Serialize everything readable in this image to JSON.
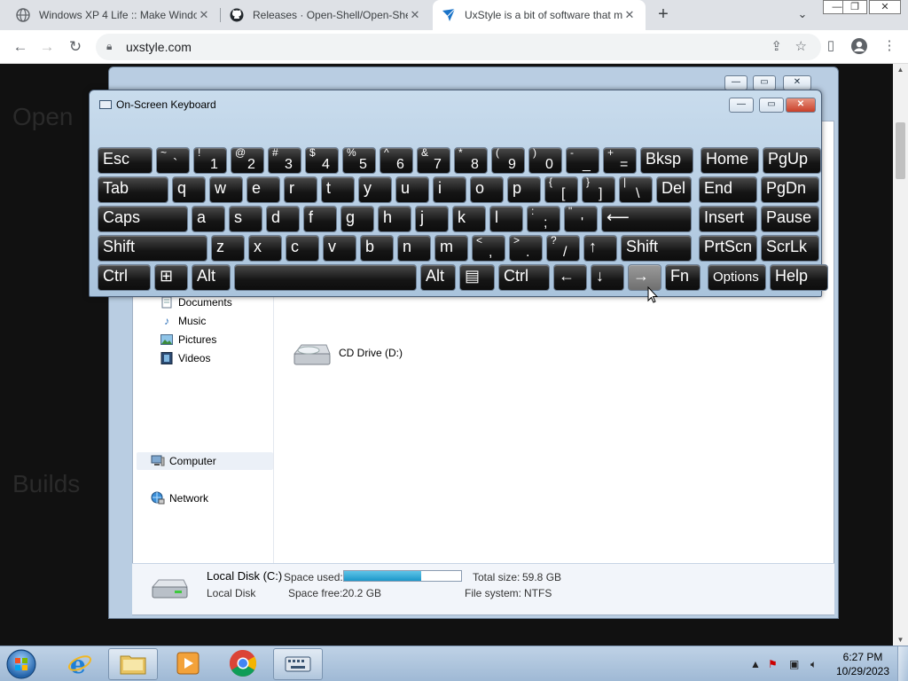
{
  "browser": {
    "tabs": [
      {
        "title": "Windows XP 4 Life :: Make Windo",
        "icon": "globe-icon"
      },
      {
        "title": "Releases · Open-Shell/Open-She",
        "icon": "github-icon"
      },
      {
        "title": "UxStyle is a bit of software that m",
        "icon": "uxstyle-icon"
      }
    ],
    "new_tab": "+",
    "tab_menu": "⌄",
    "close": "✕",
    "url": "uxstyle.com"
  },
  "page": {
    "heading1": "Open",
    "heading2": "Builds"
  },
  "explorer": {
    "nav": {
      "documents": "Documents",
      "music": "Music",
      "pictures": "Pictures",
      "videos": "Videos",
      "computer": "Computer",
      "network": "Network"
    },
    "drive_label": "CD Drive (D:)",
    "details": {
      "name": "Local Disk (C:)",
      "type": "Local Disk",
      "space_used_label": "Space used:",
      "space_used_fraction": 0.66,
      "space_free_label": "Space free:",
      "space_free_value": "20.2 GB",
      "total_size_label": "Total size:",
      "total_size_value": "59.8 GB",
      "file_system_label": "File system:",
      "file_system_value": "NTFS"
    }
  },
  "osk": {
    "title": "On-Screen Keyboard",
    "min": "—",
    "max": "▭",
    "close": "✕",
    "row1": [
      {
        "m": "Esc"
      },
      {
        "t": "~",
        "b": "`"
      },
      {
        "t": "!",
        "b": "1"
      },
      {
        "t": "@",
        "b": "2"
      },
      {
        "t": "#",
        "b": "3"
      },
      {
        "t": "$",
        "b": "4"
      },
      {
        "t": "%",
        "b": "5"
      },
      {
        "t": "^",
        "b": "6"
      },
      {
        "t": "&",
        "b": "7"
      },
      {
        "t": "*",
        "b": "8"
      },
      {
        "t": "(",
        "b": "9"
      },
      {
        "t": ")",
        "b": "0"
      },
      {
        "t": "-",
        "b": "_"
      },
      {
        "t": "+",
        "b": "="
      },
      {
        "m": "Bksp"
      },
      {
        "m": "Home"
      },
      {
        "m": "PgUp"
      }
    ],
    "row2": [
      {
        "m": "Tab"
      },
      {
        "m": "q"
      },
      {
        "m": "w"
      },
      {
        "m": "e"
      },
      {
        "m": "r"
      },
      {
        "m": "t"
      },
      {
        "m": "y"
      },
      {
        "m": "u"
      },
      {
        "m": "i"
      },
      {
        "m": "o"
      },
      {
        "m": "p"
      },
      {
        "t": "{",
        "b": "["
      },
      {
        "t": "}",
        "b": "]"
      },
      {
        "t": "|",
        "b": "\\"
      },
      {
        "m": "Del"
      },
      {
        "m": "End"
      },
      {
        "m": "PgDn"
      }
    ],
    "row3": [
      {
        "m": "Caps"
      },
      {
        "m": "a"
      },
      {
        "m": "s"
      },
      {
        "m": "d"
      },
      {
        "m": "f"
      },
      {
        "m": "g"
      },
      {
        "m": "h"
      },
      {
        "m": "j"
      },
      {
        "m": "k"
      },
      {
        "m": "l"
      },
      {
        "t": ":",
        "b": ";"
      },
      {
        "t": "\"",
        "b": "'"
      },
      {
        "m": "⟵"
      },
      {
        "m": "Insert"
      },
      {
        "m": "Pause"
      }
    ],
    "row4": [
      {
        "m": "Shift"
      },
      {
        "m": "z"
      },
      {
        "m": "x"
      },
      {
        "m": "c"
      },
      {
        "m": "v"
      },
      {
        "m": "b"
      },
      {
        "m": "n"
      },
      {
        "m": "m"
      },
      {
        "t": "<",
        "b": ","
      },
      {
        "t": ">",
        "b": "."
      },
      {
        "t": "?",
        "b": "/"
      },
      {
        "m": "↑"
      },
      {
        "m": "Shift"
      },
      {
        "m": "PrtScn"
      },
      {
        "m": "ScrLk"
      }
    ],
    "row5": [
      {
        "m": "Ctrl"
      },
      {
        "m": "⊞"
      },
      {
        "m": "Alt"
      },
      {
        "m": ""
      },
      {
        "m": "Alt"
      },
      {
        "m": "▤"
      },
      {
        "m": "Ctrl"
      },
      {
        "m": "←"
      },
      {
        "m": "↓"
      },
      {
        "m": "→"
      },
      {
        "m": "Fn"
      },
      {
        "m": "Options"
      },
      {
        "m": "Help"
      }
    ]
  },
  "taskbar": {
    "time": "6:27 PM",
    "date": "10/29/2023"
  }
}
